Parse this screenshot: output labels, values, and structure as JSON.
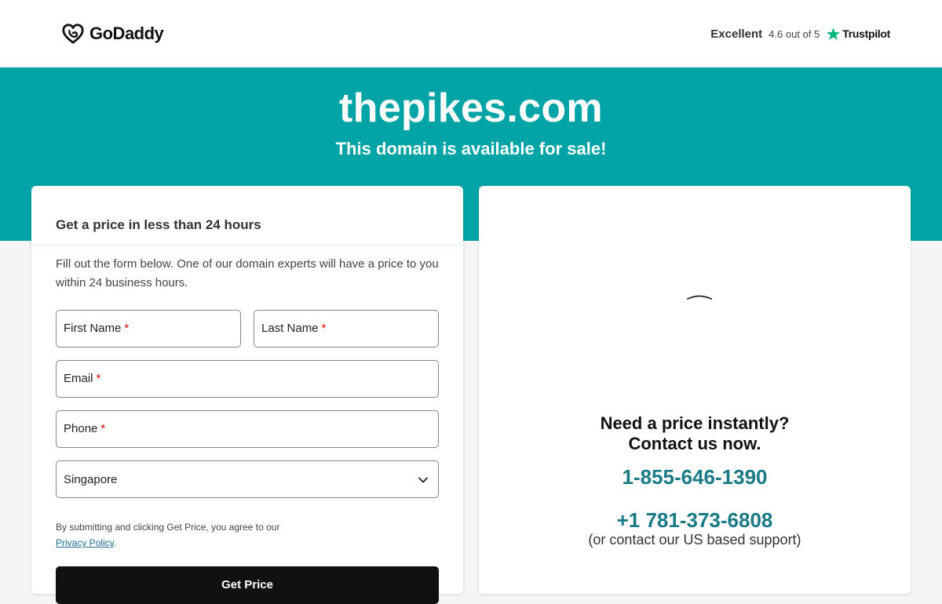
{
  "header": {
    "logo_text": "GoDaddy",
    "rating_label": "Excellent",
    "rating_score": "4.6 out of 5",
    "review_site": "Trustpilot"
  },
  "hero": {
    "domain": "thepikes.com",
    "subtitle": "This domain is available for sale!"
  },
  "form": {
    "heading": "Get a price in less than 24 hours",
    "intro": "Fill out the form below. One of our domain experts will have a price to you within 24 business hours.",
    "first_name_label": "First Name",
    "last_name_label": "Last Name",
    "email_label": "Email",
    "phone_label": "Phone",
    "required_mark": "*",
    "country_value": "Singapore",
    "legal_text": "By submitting and clicking Get Price, you agree to our",
    "privacy_link": "Privacy Policy",
    "legal_end": ".",
    "submit_label": "Get Price"
  },
  "contact": {
    "question_line1": "Need a price instantly?",
    "question_line2": "Contact us now.",
    "phone_primary": "1-855-646-1390",
    "phone_secondary": "+1 781-373-6808",
    "note": "(or contact our US based support)"
  },
  "colors": {
    "hero_bg": "#00a4a6",
    "phone_text": "#187a84",
    "button_bg": "#111111",
    "required": "#dd0000",
    "trustpilot_star": "#00b67a"
  },
  "icons": {
    "logo": "godaddy-heart-icon",
    "trustpilot": "star-icon",
    "select": "chevron-down-icon",
    "loading": "spinner-icon"
  }
}
